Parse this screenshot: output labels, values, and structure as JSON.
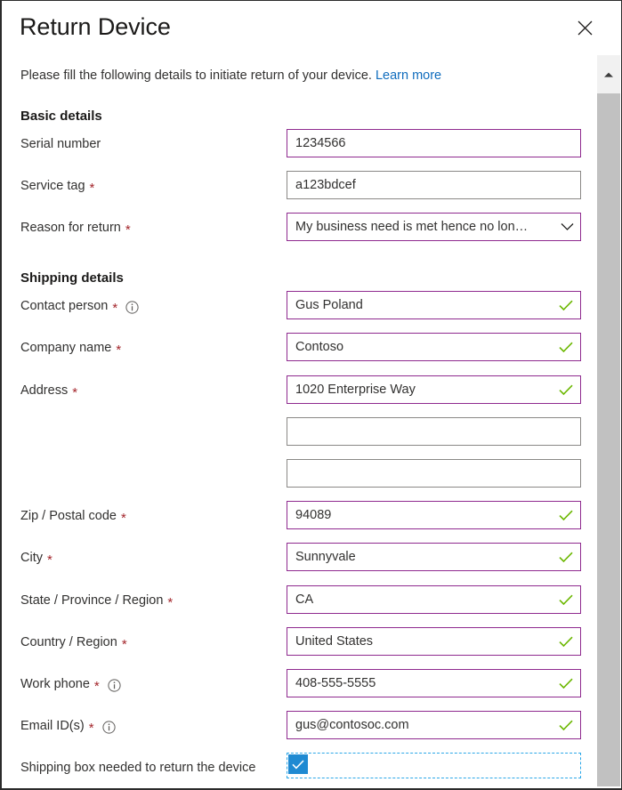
{
  "dialog": {
    "title": "Return Device",
    "close_label": "Close",
    "close_icon": "close-icon",
    "intro_text": "Please fill the following details to initiate return of your device.",
    "intro_link": "Learn more"
  },
  "sections": [
    {
      "heading": "Basic details"
    },
    {
      "heading": "Shipping details"
    }
  ],
  "fields": {
    "serial_number": {
      "label": "Serial number",
      "required": false,
      "info": false,
      "value": "1234566",
      "filled": true,
      "valid": false,
      "type": "text"
    },
    "service_tag": {
      "label": "Service tag",
      "required": true,
      "info": false,
      "value": "a123bdcef",
      "filled": false,
      "valid": false,
      "type": "text"
    },
    "reason_for_return": {
      "label": "Reason for return",
      "required": true,
      "info": false,
      "value": "My business need is met hence no lon…",
      "filled": true,
      "valid": false,
      "type": "select",
      "chevron_icon": "chevron-down-icon"
    },
    "contact_person": {
      "label": "Contact person",
      "required": true,
      "info": true,
      "value": "Gus Poland",
      "filled": true,
      "valid": true,
      "type": "text"
    },
    "company_name": {
      "label": "Company name",
      "required": true,
      "info": false,
      "value": "Contoso",
      "filled": true,
      "valid": true,
      "type": "text"
    },
    "address_line1": {
      "label": "Address",
      "required": true,
      "info": false,
      "value": "1020 Enterprise Way",
      "filled": true,
      "valid": true,
      "type": "text"
    },
    "address_line2": {
      "label": "",
      "required": false,
      "info": false,
      "value": "",
      "filled": false,
      "valid": false,
      "type": "text"
    },
    "address_line3": {
      "label": "",
      "required": false,
      "info": false,
      "value": "",
      "filled": false,
      "valid": false,
      "type": "text"
    },
    "zip_postal_code": {
      "label": "Zip / Postal code",
      "required": true,
      "info": false,
      "value": "94089",
      "filled": true,
      "valid": true,
      "type": "text"
    },
    "city": {
      "label": "City",
      "required": true,
      "info": false,
      "value": "Sunnyvale",
      "filled": true,
      "valid": true,
      "type": "text"
    },
    "state_province_region": {
      "label": "State / Province / Region",
      "required": true,
      "info": false,
      "value": "CA",
      "filled": true,
      "valid": true,
      "type": "text"
    },
    "country_region": {
      "label": "Country / Region",
      "required": true,
      "info": false,
      "value": "United States",
      "filled": true,
      "valid": true,
      "type": "text"
    },
    "work_phone": {
      "label": "Work phone",
      "required": true,
      "info": true,
      "value": "408-555-5555",
      "filled": true,
      "valid": true,
      "type": "text"
    },
    "email_ids": {
      "label": "Email ID(s)",
      "required": true,
      "info": true,
      "value": "gus@contosoc.com",
      "filled": true,
      "valid": true,
      "type": "text"
    }
  },
  "shipping_box_checkbox": {
    "label": "Shipping box needed to return the device",
    "checked": true,
    "focused": true,
    "check_icon": "checkmark-icon"
  },
  "scrollbar": {
    "up_arrow_icon": "scroll-up-arrow-icon",
    "thumb_label": "vertical-scroll-thumb"
  },
  "colors": {
    "accent_purple": "#8f2a8f",
    "valid_green": "#6bb700",
    "required_red": "#a4262c",
    "link_blue": "#0f6cbd",
    "checkbox_blue": "#1f8ad2",
    "focus_dash_blue": "#2ba7e8",
    "border_gray": "#8a8886"
  }
}
